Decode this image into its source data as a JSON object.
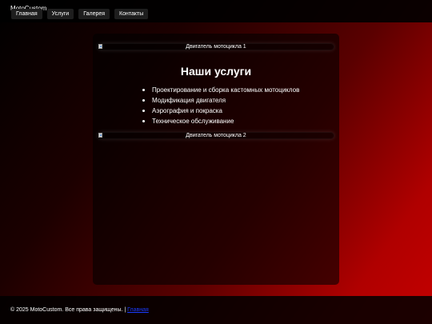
{
  "header": {
    "brand": "MotoCustom",
    "nav": [
      {
        "label": "Главная"
      },
      {
        "label": "Услуги"
      },
      {
        "label": "Галерея"
      },
      {
        "label": "Контакты"
      }
    ]
  },
  "main": {
    "images": [
      {
        "alt": "Двигатель мотоцикла 1",
        "icon": "broken-image-icon"
      },
      {
        "alt": "Двигатель мотоцикла 2",
        "icon": "broken-image-icon"
      }
    ],
    "title": "Наши услуги",
    "services": [
      "Проектирование и сборка кастомных мотоциклов",
      "Модификация двигателя",
      "Аэрография и покраска",
      "Техническое обслуживание"
    ]
  },
  "footer": {
    "copyright": "© 2025 MotoCustom. Все права защищены. |",
    "link": "Главная"
  },
  "colors": {
    "background_start": "#000000",
    "background_end": "#c40000",
    "link": "#1a3cff",
    "nav_button": "#1e1e1e"
  }
}
